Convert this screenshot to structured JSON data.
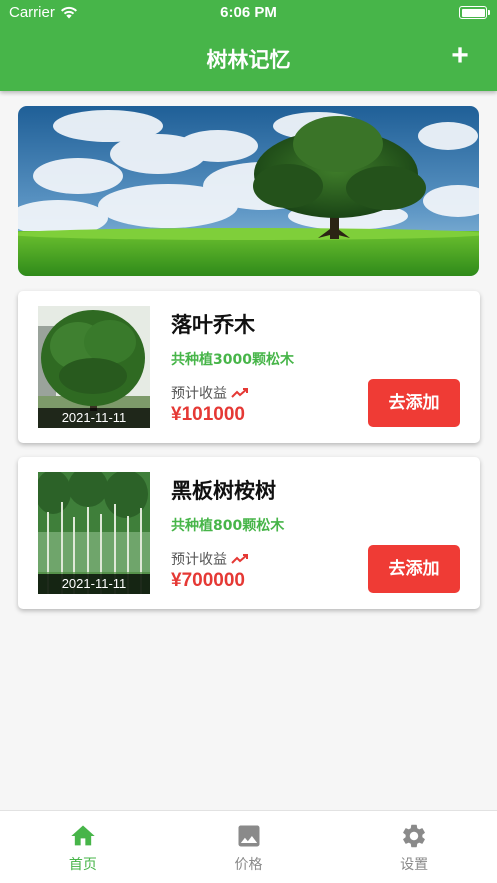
{
  "status_bar": {
    "carrier": "Carrier",
    "time": "6:06 PM"
  },
  "header": {
    "title": "树林记忆",
    "add_label": "+"
  },
  "cards": [
    {
      "name": "落叶乔木",
      "planted": "共种植3000颗松木",
      "estimate_label": "预计收益",
      "price": "¥101000",
      "date": "2021-11-11",
      "button": "去添加"
    },
    {
      "name": "黑板树桉树",
      "planted": "共种植800颗松木",
      "estimate_label": "预计收益",
      "price": "¥700000",
      "date": "2021-11-11",
      "button": "去添加"
    }
  ],
  "tabs": [
    {
      "label": "首页",
      "icon": "home-icon",
      "active": true
    },
    {
      "label": "价格",
      "icon": "image-icon",
      "active": false
    },
    {
      "label": "设置",
      "icon": "gear-icon",
      "active": false
    }
  ],
  "colors": {
    "brand_green": "#47b549",
    "price_red": "#e53935",
    "button_red": "#ef3b35"
  }
}
